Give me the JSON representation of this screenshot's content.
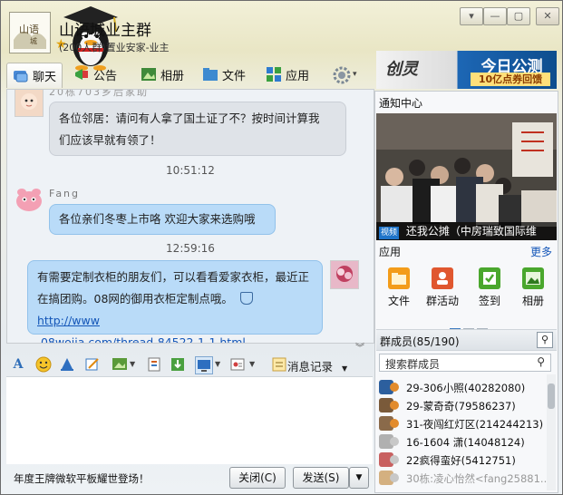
{
  "window": {
    "group_name": "山语城业主群",
    "group_info": "(200人群)置业安家-业主",
    "buttons": {
      "menu": "▾",
      "minimize": "—",
      "maximize": "▢",
      "close": "✕"
    }
  },
  "toolbar": {
    "tabs": [
      {
        "label": "聊天",
        "icon": "chat-icon"
      },
      {
        "label": "公告",
        "icon": "announcement-icon"
      },
      {
        "label": "相册",
        "icon": "album-icon"
      },
      {
        "label": "文件",
        "icon": "folder-icon"
      },
      {
        "label": "应用",
        "icon": "apps-icon"
      }
    ],
    "settings_icon": "gear-icon"
  },
  "ad": {
    "logo": "创灵",
    "title": "今日公测",
    "subtitle": "10亿点券回馈"
  },
  "chat": {
    "messages": [
      {
        "sender": "20栋703乡后家助",
        "text_lines": [
          "各位邻居：请问有人拿了国土证了不？按时间计算我",
          "们应该早就有领了！"
        ]
      },
      {
        "time": "10:51:12"
      },
      {
        "sender": "Fang",
        "text_lines": [
          "各位亲们冬枣上市咯 欢迎大家来选购哦"
        ]
      },
      {
        "time": "12:59:16"
      },
      {
        "sender": "",
        "text_lines": [
          "有需要定制衣柜的朋友们，可以看看爱家衣柜，最近正",
          "在搞团购。08网的御用衣柜定制点哦。"
        ],
        "link_1": "http://www",
        "link_2": ".08wojia.com/thread-84522-1-1.html"
      }
    ]
  },
  "format_bar": {
    "icons": [
      "font-icon",
      "emoji-icon",
      "bell-icon",
      "edit-icon",
      "image-icon",
      "screenshot-icon",
      "scissors-icon",
      "screen-share-icon",
      "phrase-icon"
    ],
    "record_label": "消息记录"
  },
  "bottom": {
    "promo": "年度王牌微软平板耀世登场！",
    "close_label": "关闭(C)",
    "send_label": "发送(S)"
  },
  "sidebar": {
    "notice_title": "通知中心",
    "video_tag": "视频",
    "video_caption": "还我公摊（中房瑞致国际维",
    "apps_title": "应用",
    "apps_more": "更多",
    "apps": [
      {
        "label": "文件",
        "icon": "folder-icon",
        "color": "#f39c1a"
      },
      {
        "label": "群活动",
        "icon": "activity-icon",
        "color": "#e0572f"
      },
      {
        "label": "签到",
        "icon": "checkin-icon",
        "color": "#4aa72d"
      },
      {
        "label": "相册",
        "icon": "album-icon",
        "color": "#4aa72d"
      }
    ],
    "members_title": "群成员(85/190)",
    "member_search_placeholder": "搜索群成员",
    "members": [
      {
        "name": "29-306小照(40282080)",
        "color": "#2c5f9e"
      },
      {
        "name": "29-蒙奇奇(79586237)",
        "color": "#7a5a3a"
      },
      {
        "name": "31-夜闯红灯区(214244213)",
        "color": "#8a6a4a"
      },
      {
        "name": "16-1604 潇(14048124)",
        "color": "#b0b0b0"
      },
      {
        "name": "22疯得蛮好(5412751)",
        "color": "#c86060"
      },
      {
        "name": "30栋:凌心怡然<fang25881...",
        "color": "#d4b080"
      }
    ]
  }
}
